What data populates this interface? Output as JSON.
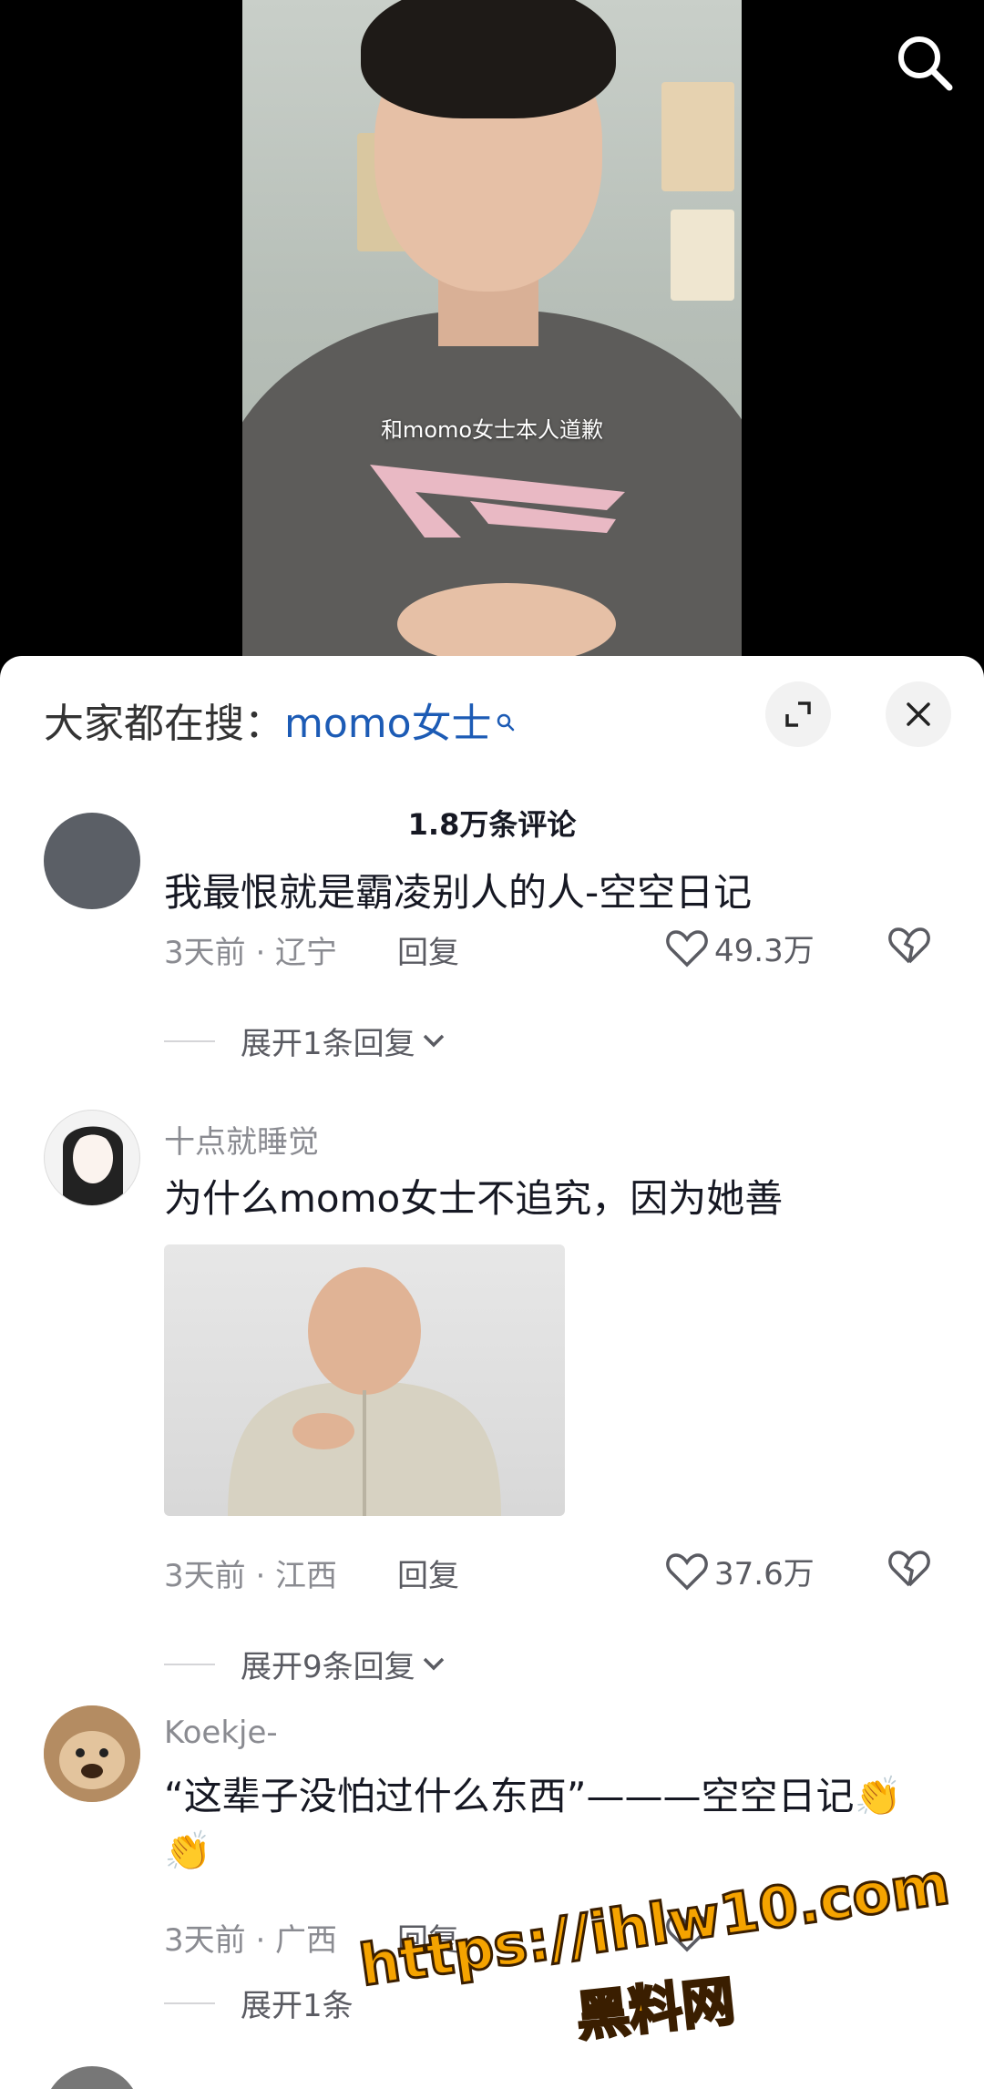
{
  "video": {
    "caption": "和momo女士本人道歉"
  },
  "suggest": {
    "prefix": "大家都在搜：",
    "keyword": "momo女士"
  },
  "comments_header": {
    "count_label": "1.8万条评论"
  },
  "comments": [
    {
      "text": "我最恨就是霸凌别人的人-空空日记",
      "meta": "3天前 · 辽宁",
      "reply_label": "回复",
      "likes": "49.3万",
      "expand_label": "展开1条回复"
    },
    {
      "username": "十点就睡觉",
      "text": "为什么momo女士不追究，因为她善",
      "meta": "3天前 · 江西",
      "reply_label": "回复",
      "likes": "37.6万",
      "expand_label": "展开9条回复"
    },
    {
      "username": "Koekje-",
      "text_line1": "“这辈子没怕过什么东西”———空空日记",
      "emoji": "👏",
      "meta": "3天前 · 广西",
      "reply_label": "回复",
      "expand_label": "展开1条"
    }
  ],
  "watermark": {
    "url": "https://ihlw10.com",
    "name": "黑料网"
  },
  "colors": {
    "keyword": "#1c5bb5",
    "muted": "#8a8b91",
    "watermark": "#f5a300"
  }
}
